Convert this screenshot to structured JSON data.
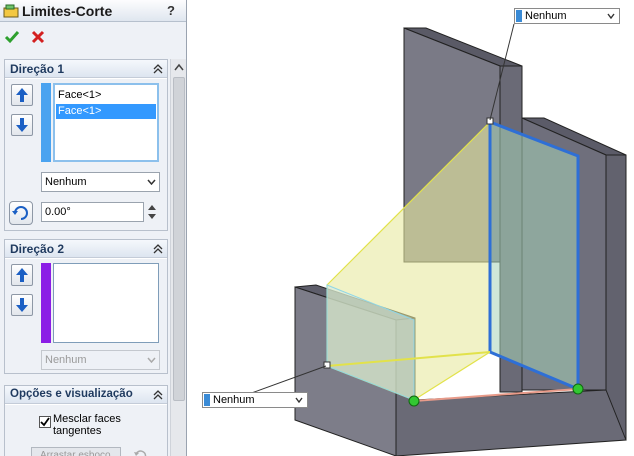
{
  "panel": {
    "title": "Limites-Corte",
    "help": "?",
    "direction1": {
      "title": "Direção 1",
      "items": [
        "Face<1>",
        "Face<1>"
      ],
      "condition": "Nenhum",
      "angle": "0.00°",
      "color": "#4aa3f0"
    },
    "direction2": {
      "title": "Direção 2",
      "condition": "Nenhum",
      "color": "#8b1ee6"
    },
    "options": {
      "title": "Opções e visualização",
      "merge_label": "Mesclar faces tangentes",
      "merge_checked": true,
      "next_button": "Arrastar esboço"
    }
  },
  "viewport": {
    "callout_top": "Nenhum",
    "callout_left": "Nenhum"
  }
}
